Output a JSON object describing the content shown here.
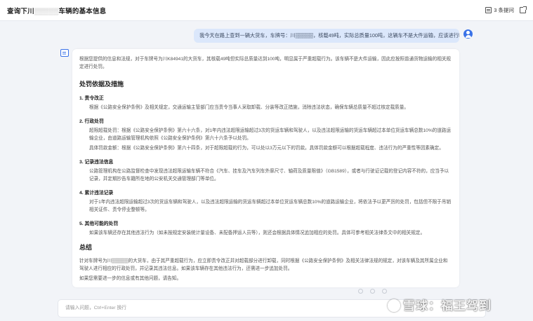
{
  "header": {
    "title_prefix": "查询下川",
    "title_mask": "▒▒▒▒▒",
    "title_suffix": "车辆的基本信息",
    "question_count": "3 条提问"
  },
  "user_message": "我今天在路上查到一辆大货车，车牌号：川▒▒▒▒▒，核载49吨，实际总质量100吨，这辆车不是大件运输，应该进行哪些处罚？",
  "answer": {
    "intro": "根据您提供的信息和法规，对于车牌号为川K84941的大货车，其核载49吨但实际总质量达到100吨，明显属于严重超载行为。该车辆不是大件运输，因此应按照普通货物运输的相关规定进行处罚。",
    "section_title": "处罚依据及措施",
    "items": [
      {
        "heading": "1. 责令改正",
        "lines": [
          "根据《公路安全保护条例》及相关规定，交通运输主管部门应当责令当事人采取卸载、分装等改正措施，消除违法状态，确保车辆总质量不超过核定载质量。"
        ]
      },
      {
        "heading": "2. 行政处罚",
        "lines": [
          "超限超载处罚：根据《公路安全保护条例》第六十六条，对1年内违法超限运输超过3次的货运车辆和驾驶人，以及违法超限运输的货运车辆超过本单位货运车辆总数10%的道路运输企业，由道路运输管理机构依照《公路安全保护条例》第六十六条予以处罚。",
          "具体罚款金额：根据《公路安全保护条例》第六十四条，对于超限超载的行为，可以处以3万元以下的罚款。具体罚款金额可以根据超载程度、违法行为的严重性等因素确定。"
        ]
      },
      {
        "heading": "3. 记录违法信息",
        "lines": [
          "公路管理机构在公路监督检查中发现违法超限运输车辆不符合《汽车、挂车及汽车列车外廓尺寸、轴荷及质量限值》（GB1589），或者与行驶证记载的登记内容不符的，应当予以记录，并定期抄告车籍所在地的公安机关交通管理部门等单位。"
        ]
      },
      {
        "heading": "4. 累计违法记录",
        "lines": [
          "对于1年内违法超限运输超过3次的货运车辆和驾驶人，以及违法超限运输的货运车辆超过本单位货运车辆总数10%的道路运输企业，将依法予以更严厉的处罚，包括但不限于吊销相关证件、责令停业整顿等。"
        ]
      },
      {
        "heading": "5. 其他可能的处罚",
        "lines": [
          "如果该车辆还存在其他违法行为（如未按规定安装统计量设备、未配备押运人员等），则还会根据具体情况追加相应的处罚。具体可参考相关法律条文中的相关规定。"
        ]
      }
    ],
    "summary_title": "总结",
    "summary": "针对车牌号为川▒▒▒▒▒的大货车，由于其严重超载行为，应立即责令改正并对超载部分进行卸载，同时根据《公路安全保护条例》及相关法律法规的规定，对该车辆及其所属企业和驾驶人进行相应的行政处罚，并记录其违法信息。如果该车辆存在其他违法行为，还需进一步追加处罚。",
    "closing": "如果您需要进一步的信息或有其他问题，请告知。"
  },
  "input": {
    "placeholder": "请输入问题，Ctrl+Enter 换行"
  },
  "watermark": "雪球：福王驾到"
}
